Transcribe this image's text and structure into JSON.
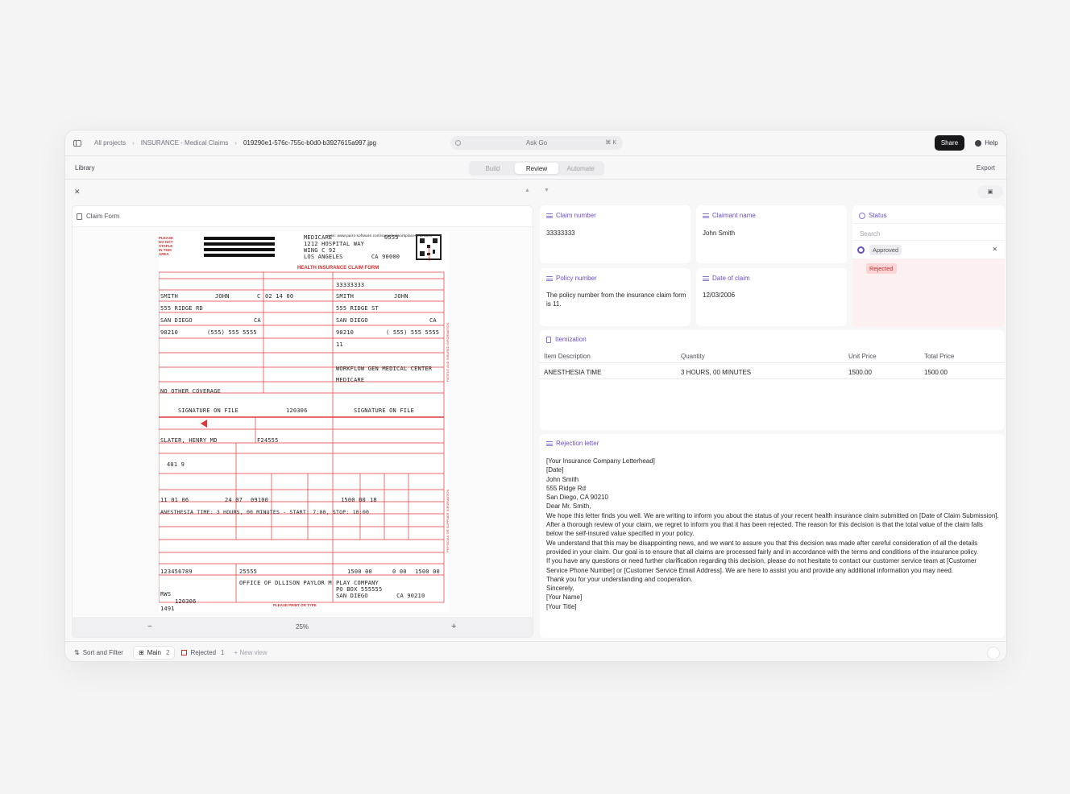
{
  "topbar": {
    "crumbs": [
      "All projects",
      "INSURANCE - Medical Claims",
      "019290e1-576c-755c-b0d0-b3927615a997.jpg"
    ],
    "ask": "Ask Go",
    "shortcut": "⌘ K",
    "share": "Share",
    "help": "Help"
  },
  "toolbar": {
    "library": "Library",
    "tabs": [
      "Build",
      "Review",
      "Automate"
    ],
    "active_tab": "Review",
    "export": "Export"
  },
  "document": {
    "title": "Claim Form",
    "zoom": "25%",
    "form": {
      "url": "visit: www.pairs-software.com/samples/workplace#=1e1500",
      "carrier_lines": [
        "MEDICARE",
        "1212 HOSPITAL WAY",
        "WING C 92",
        "LOS ANGELES"
      ],
      "carrier_code": "0555",
      "carrier_state_zip": "CA  90000",
      "please": [
        "PLEASE",
        "DO NOT",
        "STAPLE",
        "IN THIS",
        "AREA"
      ],
      "form_title": "HEALTH INSURANCE CLAIM FORM",
      "insured_id": "33333333",
      "patient_last": "SMITH",
      "patient_first": "JOHN",
      "patient_mi": "C",
      "dob": "02  14  00",
      "insured_last": "SMITH",
      "insured_first": "JOHN",
      "patient_addr": "555 RIDGE RD",
      "insured_addr": "555 RIDGE ST",
      "patient_city": "SAN DIEGO",
      "patient_state": "CA",
      "insured_city": "SAN DIEGO",
      "insured_state": "CA",
      "patient_zip": "90210",
      "patient_phone": "(555) 555 5555",
      "insured_zip": "90210",
      "insured_phone": "( 555) 555 5555",
      "group": "11",
      "employer": "WORKFLOW GEN MEDICAL CENTER",
      "plan": "MEDICARE",
      "other": "NO OTHER COVERAGE",
      "sig1": "SIGNATURE  ON  FILE",
      "sig_date": "120306",
      "sig2": "SIGNATURE  ON  FILE",
      "referring": "SLATER, HENRY MD",
      "ref_id": "F24555",
      "diag": "401  9",
      "svc_date": "11  01  06",
      "pos": "24  07",
      "cpt": "09100",
      "charge": "1500  00",
      "units": "18",
      "line_note": "ANESTHESIA  TIME:    3 HOURS,    00 MINUTES    -        START:   7:00,  STOP:   10:00",
      "tax_id": "123456789",
      "acct": "25555",
      "total": "1500  00",
      "paid": "0  00",
      "balance": "1500  00",
      "facility": "OFFICE OF DLLISON PAYLOR M",
      "billing": [
        "PLAY COMPANY",
        "PO BOX 555555",
        "SAN DIEGO"
      ],
      "billing_state_zip": "CA  90210",
      "phys_sig": "RWS",
      "phys_date": "120306",
      "bottom_num": "1491",
      "print_note": "PLEASE PRINT OR TYPE",
      "side_label_1": "CARRIER",
      "side_label_2": "PATIENT AND INSURED INFORMATION",
      "side_label_3": "PHYSICIAN OR SUPPLIER INFORMATION"
    }
  },
  "fields": {
    "claim_number": {
      "label": "Claim number",
      "value": "33333333"
    },
    "claimant_name": {
      "label": "Claimant name",
      "value": "John Smith"
    },
    "policy_number": {
      "label": "Policy number",
      "value": "The policy number from the insurance claim form is 11."
    },
    "date_of_claim": {
      "label": "Date of claim",
      "value": "12/03/2006"
    },
    "status": {
      "label": "Status",
      "search_placeholder": "Search",
      "selected": "Approved",
      "option": "Rejected"
    }
  },
  "itemization": {
    "label": "Itemization",
    "headers": [
      "Item Description",
      "Quantity",
      "Unit Price",
      "Total Price"
    ],
    "rows": [
      [
        "ANESTHESIA TIME",
        "3 HOURS, 00 MINUTES",
        "1500.00",
        "1500.00"
      ]
    ]
  },
  "rejection_letter": {
    "label": "Rejection letter",
    "lines": [
      "[Your Insurance Company Letterhead]",
      "[Date]",
      "John Smith",
      "555 Ridge Rd",
      "San Diego, CA 90210",
      "Dear Mr. Smith,",
      "We hope this letter finds you well. We are writing to inform you about the status of your recent health insurance claim submitted on [Date of Claim Submission].",
      "After a thorough review of your claim, we regret to inform you that it has been rejected. The reason for this decision is that the total value of the claim falls below the self-insured value specified in your policy.",
      "We understand that this may be disappointing news, and we want to assure you that this decision was made after careful consideration of all the details provided in your claim. Our goal is to ensure that all claims are processed fairly and in accordance with the terms and conditions of the insurance policy.",
      "If you have any questions or need further clarification regarding this decision, please do not hesitate to contact our customer service team at [Customer Service Phone Number] or [Customer Service Email Address]. We are here to assist you and provide any additional information you may need.",
      "Thank you for your understanding and cooperation.",
      "Sincerely,",
      "[Your Name]",
      "[Your Title]"
    ]
  },
  "bottombar": {
    "sort": "Sort and Filter",
    "main_label": "Main",
    "main_count": "2",
    "rejected_label": "Rejected",
    "rejected_count": "1",
    "new_view": "+ New view"
  }
}
